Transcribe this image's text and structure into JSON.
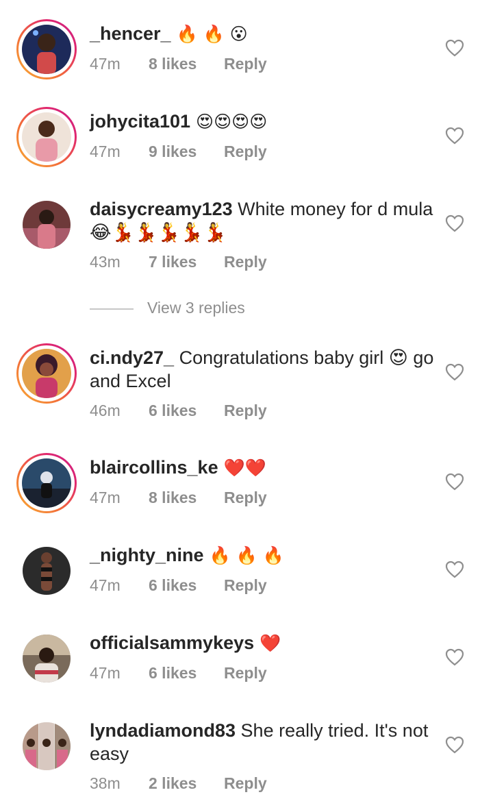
{
  "comments": [
    {
      "username": "_hencer_",
      "text": " 🔥 🔥 😮",
      "time": "47m",
      "likes": "8 likes",
      "reply": "Reply",
      "story_ring": true,
      "avatar_color": "#5a2a2a"
    },
    {
      "username": "johycita101",
      "text": " 😍😍😍😍",
      "time": "47m",
      "likes": "9 likes",
      "reply": "Reply",
      "story_ring": true,
      "avatar_color": "#c98a85"
    },
    {
      "username": "daisycreamy123",
      "text": " White money for d mula😂💃💃💃💃💃",
      "time": "43m",
      "likes": "7 likes",
      "reply": "Reply",
      "story_ring": false,
      "avatar_color": "#7a3a3a"
    },
    {
      "username": "ci.ndy27_",
      "text": " Congratulations baby girl 😍 go and Excel",
      "time": "46m",
      "likes": "6 likes",
      "reply": "Reply",
      "story_ring": true,
      "avatar_color": "#d98a3a"
    },
    {
      "username": "blaircollins_ke",
      "text": " ❤️❤️",
      "time": "47m",
      "likes": "8 likes",
      "reply": "Reply",
      "story_ring": true,
      "avatar_color": "#1f3a5a"
    },
    {
      "username": "_nighty_nine",
      "text": " 🔥 🔥 🔥",
      "time": "47m",
      "likes": "6 likes",
      "reply": "Reply",
      "story_ring": false,
      "avatar_color": "#2a2a2a"
    },
    {
      "username": "officialsammykeys",
      "text": " ❤️",
      "time": "47m",
      "likes": "6 likes",
      "reply": "Reply",
      "story_ring": false,
      "avatar_color": "#6a5040"
    },
    {
      "username": "lyndadiamond83",
      "text": " She really tried. It's not easy",
      "time": "38m",
      "likes": "2 likes",
      "reply": "Reply",
      "story_ring": false,
      "avatar_color": "#b0a8a0"
    }
  ],
  "view_replies": "View 3 replies",
  "colors": {
    "text": "#262626",
    "secondary": "#8e8e8e",
    "story_ring_start": "#f9b233",
    "story_ring_end": "#c4218c"
  },
  "icons": {
    "like": "heart-outline-icon"
  }
}
